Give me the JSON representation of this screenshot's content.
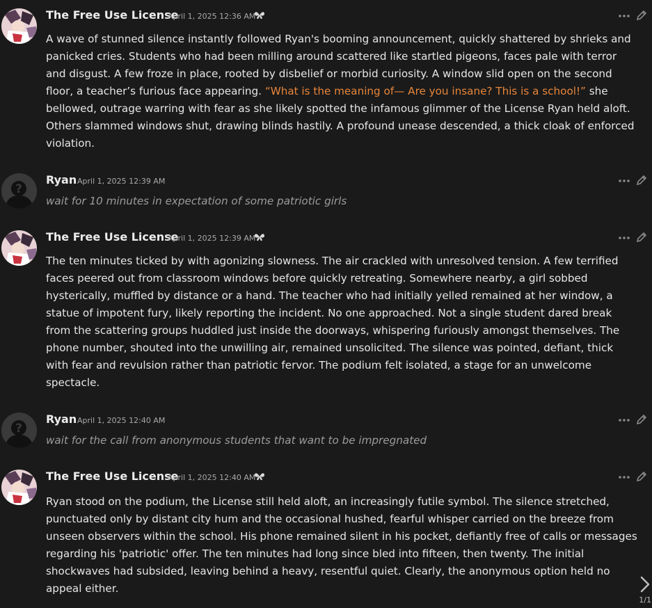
{
  "messages": [
    {
      "sender": "The Free Use License",
      "timestamp": "April 1, 2025 12:36 AM",
      "paragraph": [
        {
          "t": "A wave of stunned silence instantly followed Ryan's booming announcement, quickly shattered by shrieks and panicked cries. Students who had been milling around scattered like startled pigeons, faces pale with terror and disgust. A few froze in place, rooted by disbelief or morbid curiosity. A window slid open on the second floor, a teacher’s furious face appearing. "
        },
        {
          "t": "“What is the meaning of— Are you insane? This is a school!”",
          "quote": true
        },
        {
          "t": " she bellowed, outrage warring with fear as she likely spotted the infamous glimmer of the License Ryan held aloft. Others slammed windows shut, drawing blinds hastily. A profound unease descended, a thick cloak of enforced violation."
        }
      ]
    },
    {
      "sender": "Ryan",
      "timestamp": "April 1, 2025 12:39 AM",
      "text": "wait for 10 minutes in expectation of some patriotic girls"
    },
    {
      "sender": "The Free Use License",
      "timestamp": "April 1, 2025 12:39 AM",
      "paragraph": [
        {
          "t": "The ten minutes ticked by with agonizing slowness. The air crackled with unresolved tension. A few terrified faces peered out from classroom windows before quickly retreating. Somewhere nearby, a girl sobbed hysterically, muffled by distance or a hand. The teacher who had initially yelled remained at her window, a statue of impotent fury, likely reporting the incident. No one approached. Not a single student dared break from the scattering groups huddled just inside the doorways, whispering furiously amongst themselves. The phone number, shouted into the unwilling air, remained unsolicited. The silence was pointed, defiant, thick with fear and revulsion rather than patriotic fervor. The podium felt isolated, a stage for an unwelcome spectacle."
        }
      ]
    },
    {
      "sender": "Ryan",
      "timestamp": "April 1, 2025 12:40 AM",
      "text": "wait for the call from anonymous students that want to be impregnated"
    },
    {
      "sender": "The Free Use License",
      "timestamp": "April 1, 2025 12:40 AM",
      "paragraph": [
        {
          "t": "Ryan stood on the podium, the License still held aloft, an increasingly futile symbol. The silence stretched, punctuated only by distant city hum and the occasional hushed, fearful whisper carried on the breeze from unseen observers within the school. His phone remained silent in his pocket, defiantly free of calls or messages regarding his 'patriotic' offer. The ten minutes had long since bled into fifteen, then twenty. The initial shockwaves had subsided, leaving behind a heavy, resentful quiet. Clearly, the anonymous option held no appeal either."
        }
      ]
    }
  ],
  "swipe": {
    "counter": "1/1"
  },
  "colors": {
    "background": "#1a1a1a",
    "text": "#e6e6e6",
    "quote": "#e8863a",
    "user_text": "#9c9c9c",
    "timestamp": "#a9a9a9"
  }
}
